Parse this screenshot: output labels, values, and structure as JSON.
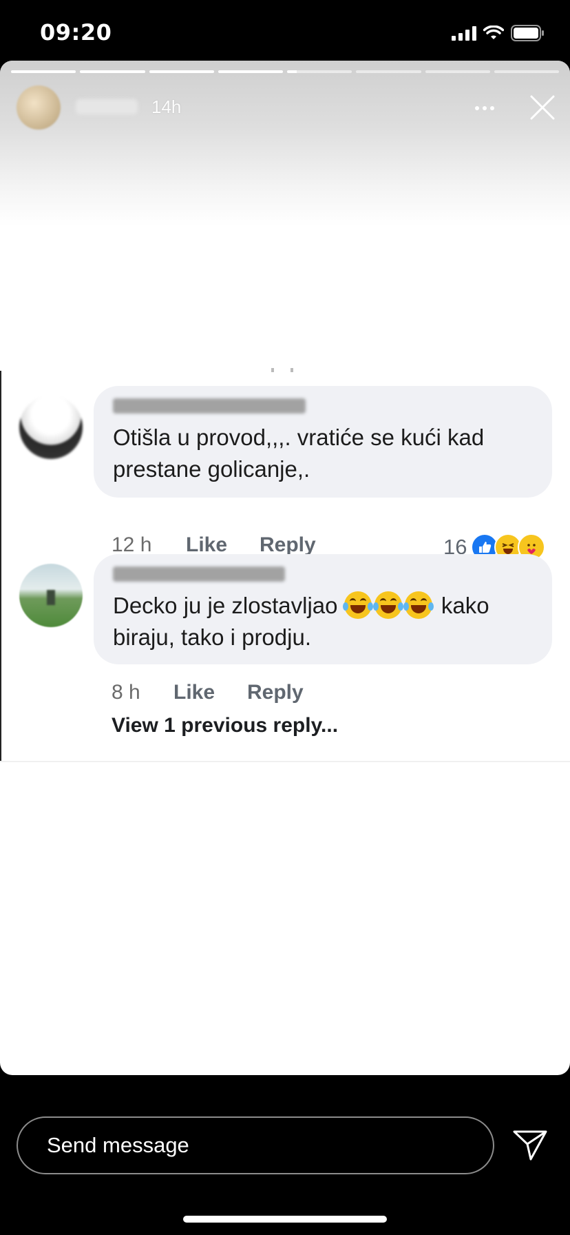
{
  "status_bar": {
    "time": "09:20"
  },
  "story": {
    "owner_age": "14h",
    "progress_segments": 8,
    "current_segment": 5,
    "current_segment_progress": 0.15
  },
  "comments": [
    {
      "text": "Otišla u provod,,,. vratiće se kući kad prestane golicanje,.",
      "time": "12 h",
      "like_label": "Like",
      "reply_label": "Reply",
      "reaction_count": "16",
      "reactions": [
        "like-icon",
        "haha-icon",
        "care-icon"
      ]
    },
    {
      "text_before_emoji": "Decko ju je zlostavljao",
      "emoji": [
        "laughing-tears-emoji",
        "laughing-tears-emoji",
        "laughing-tears-emoji"
      ],
      "text_after_emoji": "kako biraju, tako i prodju.",
      "time": "8 h",
      "like_label": "Like",
      "reply_label": "Reply"
    }
  ],
  "view_previous": "View 1 previous reply...",
  "message": {
    "placeholder": "Send message"
  },
  "colors": {
    "like_blue": "#1877f2",
    "bubble_bg": "#f0f1f5",
    "reaction_yellow": "#f7c51e"
  }
}
